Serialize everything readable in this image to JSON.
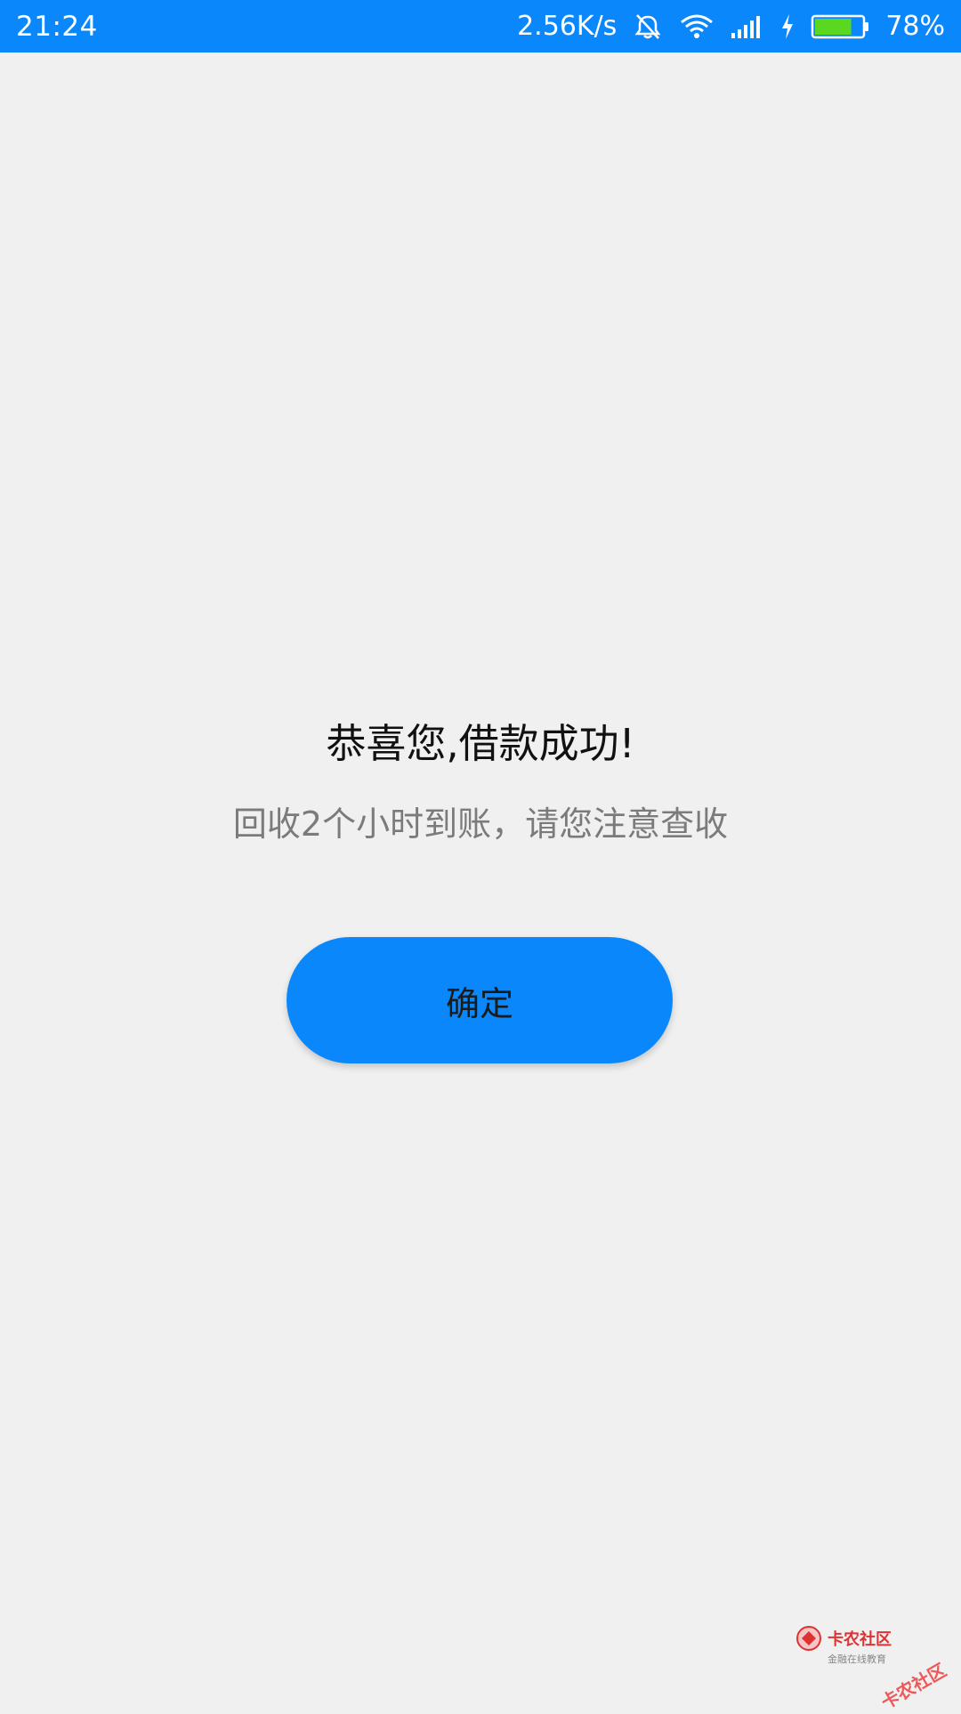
{
  "status_bar": {
    "time": "21:24",
    "network_speed": "2.56K/s",
    "battery_percent": "78%",
    "icons": [
      "alarm-off-icon",
      "wifi-icon",
      "signal-icon",
      "charging-icon",
      "battery-icon"
    ],
    "battery_level": 0.78,
    "colors": {
      "background": "#0a88fb",
      "battery_fill": "#5ad81f"
    }
  },
  "main": {
    "title": "恭喜您,借款成功!",
    "subtitle": "回收2个小时到账，请您注意查收",
    "confirm_label": "确定"
  },
  "watermark": {
    "brand": "卡农社区",
    "slogan": "金融在线教育",
    "stamp": "卡农社区",
    "icon": "kanong-logo-icon"
  },
  "colors": {
    "page_background": "#f0f0f0",
    "accent": "#0a88fb",
    "title_text": "#111111",
    "subtitle_text": "#7b7b7b"
  }
}
